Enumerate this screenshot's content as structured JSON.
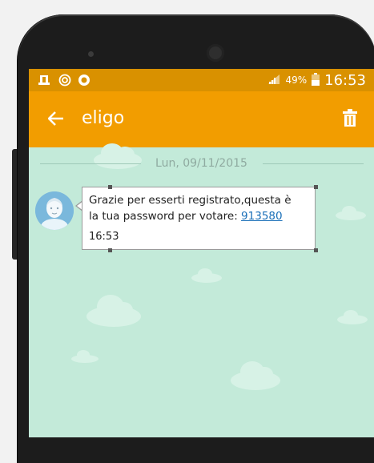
{
  "status_bar": {
    "battery": "49%",
    "time": "16:53",
    "background": "#d99100"
  },
  "app_bar": {
    "title": "eligo",
    "background": "#f29d00",
    "back_icon": "arrow-back-icon",
    "delete_icon": "trash-icon"
  },
  "chat": {
    "background": "#c3ead9",
    "date": "Lun, 09/11/2015",
    "messages": [
      {
        "text_line1": "Grazie per esserti registrato,questa è",
        "text_line2_prefix": "la tua password per votare: ",
        "code": "913580",
        "time": "16:53"
      }
    ]
  }
}
